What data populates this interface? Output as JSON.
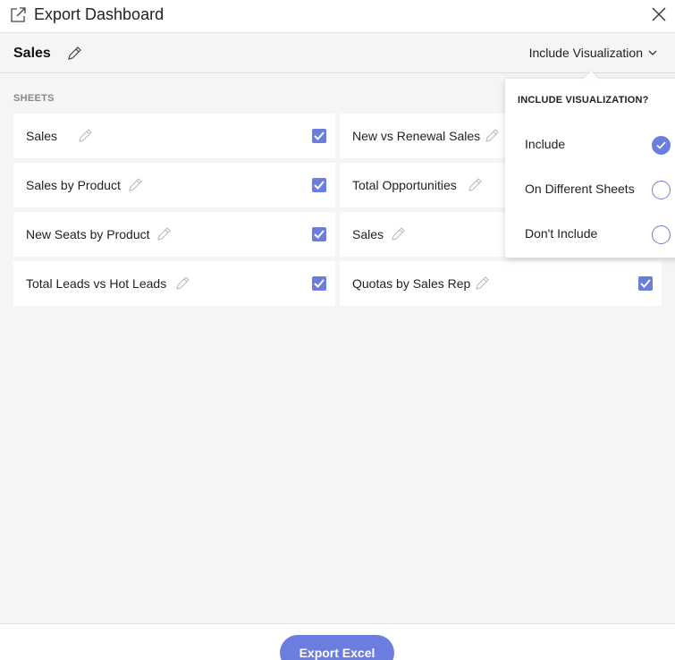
{
  "window": {
    "title": "Export Dashboard",
    "icon": "external-link-icon",
    "close_icon": "close-icon"
  },
  "header": {
    "dashboard_name": "Sales",
    "edit_icon": "pencil-icon",
    "visualization_toggle": "Include Visualization"
  },
  "sheets": {
    "label": "SHEETS",
    "items": [
      {
        "name": "Sales",
        "checked": true
      },
      {
        "name": "New vs Renewal Sales",
        "checked": true
      },
      {
        "name": "Sales by Product",
        "checked": true
      },
      {
        "name": "Total Opportunities",
        "checked": true
      },
      {
        "name": "New Seats by Product",
        "checked": true
      },
      {
        "name": "Sales",
        "checked": true
      },
      {
        "name": "Total Leads vs Hot Leads",
        "checked": true
      },
      {
        "name": "Quotas by Sales Rep",
        "checked": true
      }
    ]
  },
  "visualization_menu": {
    "heading": "INCLUDE VISUALIZATION?",
    "options": [
      {
        "label": "Include",
        "selected": true
      },
      {
        "label": "On Different Sheets",
        "selected": false
      },
      {
        "label": "Don't Include",
        "selected": false
      }
    ]
  },
  "footer": {
    "export_label": "Export Excel"
  },
  "colors": {
    "accent": "#6c7de0",
    "background": "#f5f5f7"
  }
}
